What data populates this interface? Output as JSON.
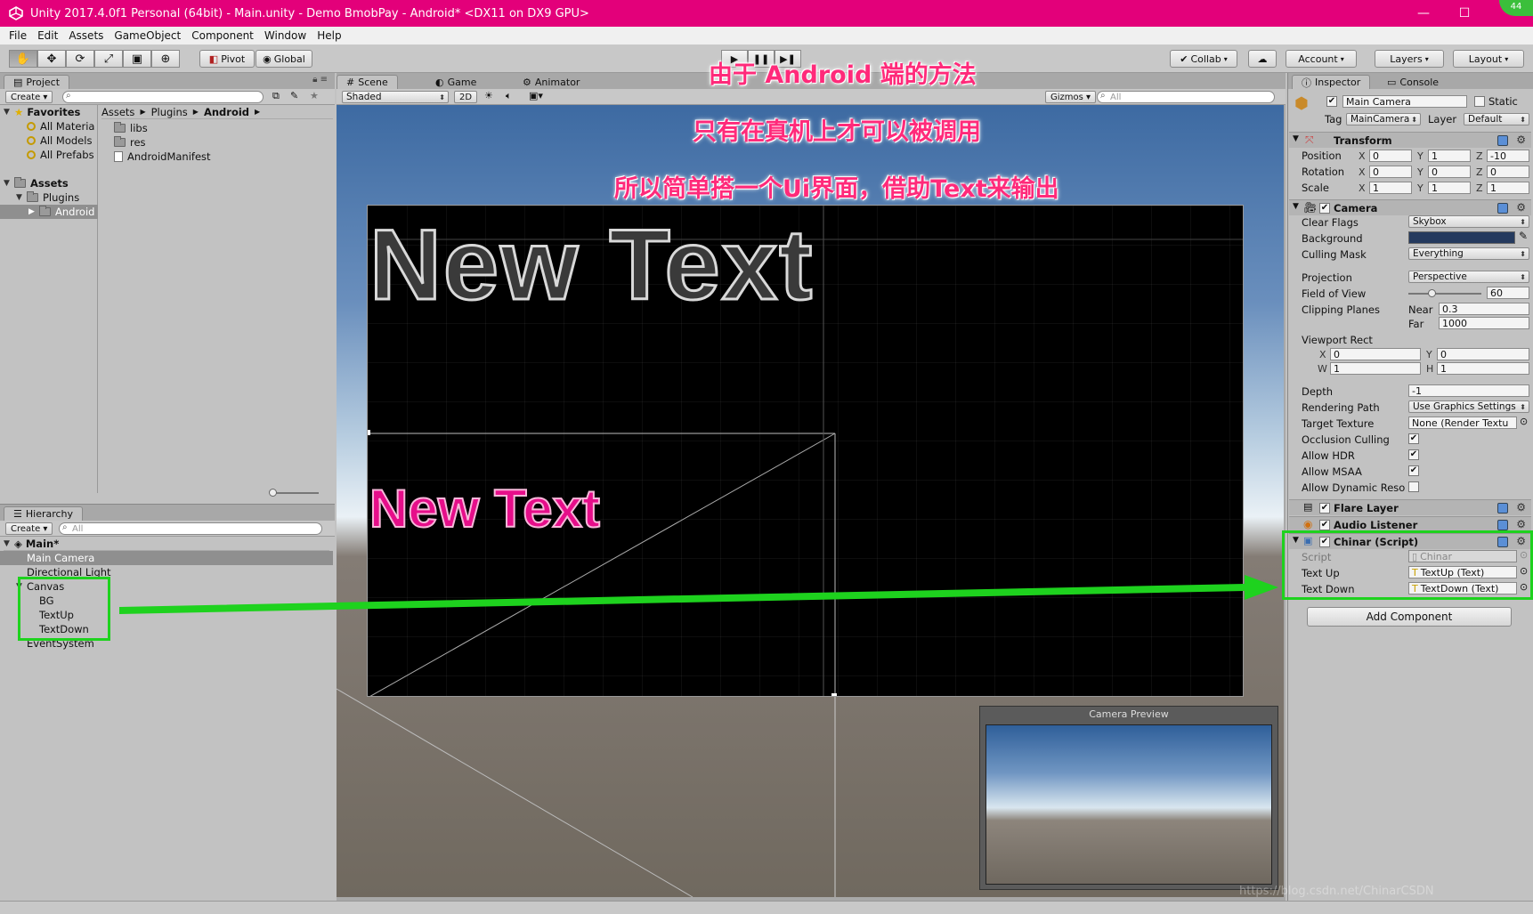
{
  "window": {
    "title": "Unity 2017.4.0f1 Personal (64bit) - Main.unity - Demo BmobPay - Android* <DX11 on DX9 GPU>",
    "minimize": "—",
    "maximize": "☐",
    "badge": "44"
  },
  "menu": [
    "File",
    "Edit",
    "Assets",
    "GameObject",
    "Component",
    "Window",
    "Help"
  ],
  "toolbar": {
    "pivot": "Pivot",
    "global": "Global",
    "collab": "Collab",
    "account": "Account",
    "layers": "Layers",
    "layout": "Layout"
  },
  "project": {
    "tab": "Project",
    "create": "Create",
    "favorites": "Favorites",
    "favorite_items": [
      "All Materia",
      "All Models",
      "All Prefabs"
    ],
    "assets": "Assets",
    "plugins": "Plugins",
    "android": "Android",
    "breadcrumb": [
      "Assets",
      "Plugins",
      "Android"
    ],
    "files": [
      "libs",
      "res",
      "AndroidManifest"
    ]
  },
  "hierarchy": {
    "tab": "Hierarchy",
    "create": "Create",
    "search_placeholder": "All",
    "scene": "Main*",
    "items": [
      "Main Camera",
      "Directional Light",
      "Canvas",
      "BG",
      "TextUp",
      "TextDown",
      "EventSystem"
    ]
  },
  "scene": {
    "tab_scene": "Scene",
    "tab_game": "Game",
    "tab_animator": "Animator",
    "shaded": "Shaded",
    "mode_2d": "2D",
    "gizmos": "Gizmos",
    "search_placeholder": "All",
    "big_text": "New Text",
    "small_text": "New Text",
    "camera_preview": "Camera Preview",
    "watermark": "https://blog.csdn.net/ChinarCSDN"
  },
  "annotations": [
    "由于 Android 端的方法",
    "只有在真机上才可以被调用",
    "所以简单搭一个Ui界面，借助Text来输出"
  ],
  "inspector": {
    "tab": "Inspector",
    "console": "Console",
    "object_name": "Main Camera",
    "static": "Static",
    "tag_label": "Tag",
    "tag": "MainCamera",
    "layer_label": "Layer",
    "layer": "Default",
    "transform": {
      "title": "Transform",
      "position_label": "Position",
      "rotation_label": "Rotation",
      "scale_label": "Scale",
      "position": [
        "0",
        "1",
        "-10"
      ],
      "rotation": [
        "0",
        "0",
        "0"
      ],
      "scale": [
        "1",
        "1",
        "1"
      ]
    },
    "axes": [
      "X",
      "Y",
      "Z"
    ],
    "camera": {
      "title": "Camera",
      "clear_flags_label": "Clear Flags",
      "clear_flags": "Skybox",
      "background_label": "Background",
      "culling_mask_label": "Culling Mask",
      "culling_mask": "Everything",
      "projection_label": "Projection",
      "projection": "Perspective",
      "fov_label": "Field of View",
      "fov": "60",
      "clipping_label": "Clipping Planes",
      "near_label": "Near",
      "near": "0.3",
      "far_label": "Far",
      "far": "1000",
      "viewport_label": "Viewport Rect",
      "vp_x_label": "X",
      "vp_x": "0",
      "vp_y_label": "Y",
      "vp_y": "0",
      "vp_w_label": "W",
      "vp_w": "1",
      "vp_h_label": "H",
      "vp_h": "1",
      "depth_label": "Depth",
      "depth": "-1",
      "rendering_path_label": "Rendering Path",
      "rendering_path": "Use Graphics Settings",
      "target_texture_label": "Target Texture",
      "target_texture": "None (Render Textu",
      "occlusion_label": "Occlusion Culling",
      "hdr_label": "Allow HDR",
      "msaa_label": "Allow MSAA",
      "dynamic_label": "Allow Dynamic Reso"
    },
    "flare_layer": "Flare Layer",
    "audio_listener": "Audio Listener",
    "chinar": {
      "title": "Chinar (Script)",
      "script_label": "Script",
      "script": "Chinar",
      "text_up_label": "Text Up",
      "text_up": "TextUp (Text)",
      "text_down_label": "Text Down",
      "text_down": "TextDown (Text)"
    },
    "add_component": "Add Component"
  },
  "colors": {
    "title_bar": "#e3007a",
    "annotation": "#ff2a7a",
    "highlight_green": "#1ed21e",
    "camera_bg": "#253a5e"
  }
}
